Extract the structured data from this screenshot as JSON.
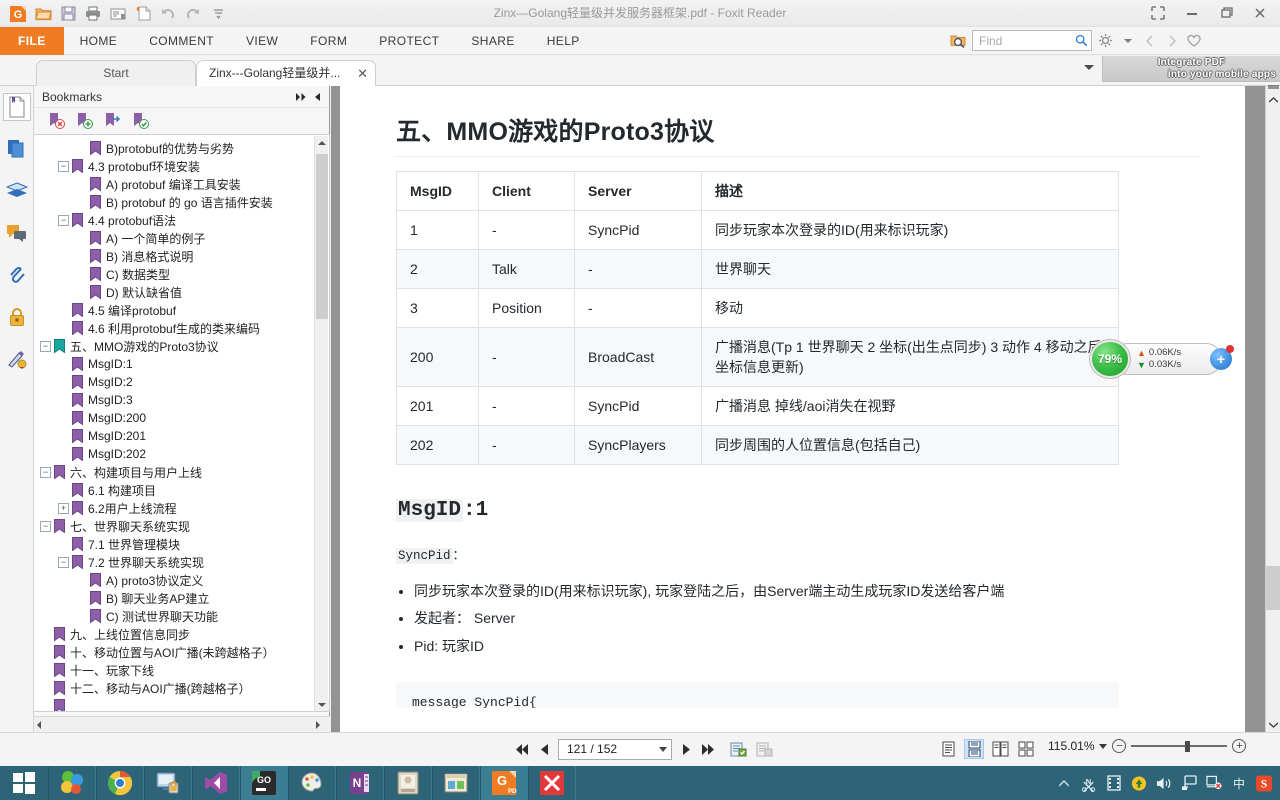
{
  "window": {
    "title": "Zinx—Golang轻量级并发服务器框架.pdf - Foxit Reader",
    "restore_icon": "restore-icon",
    "minimize_icon": "minimize-icon",
    "maximize_icon": "maximize-icon",
    "close_icon": "close-icon"
  },
  "quick_access": [
    {
      "name": "foxit-logo-icon",
      "glyph": "G"
    },
    {
      "name": "open-icon",
      "glyph": "Ὄ2"
    },
    {
      "name": "save-icon",
      "glyph": "■"
    },
    {
      "name": "print-icon",
      "glyph": "⎙"
    },
    {
      "name": "email-icon",
      "glyph": "✉"
    },
    {
      "name": "create-pdf-icon",
      "glyph": "✳"
    },
    {
      "name": "undo-icon",
      "glyph": "↶"
    },
    {
      "name": "redo-icon",
      "glyph": "↷"
    },
    {
      "name": "customize-qat-icon",
      "glyph": "▾"
    }
  ],
  "ribbon": {
    "tabs": [
      {
        "label": "FILE",
        "active": true
      },
      {
        "label": "HOME",
        "active": false
      },
      {
        "label": "COMMENT",
        "active": false
      },
      {
        "label": "VIEW",
        "active": false
      },
      {
        "label": "FORM",
        "active": false
      },
      {
        "label": "PROTECT",
        "active": false
      },
      {
        "label": "SHARE",
        "active": false
      },
      {
        "label": "HELP",
        "active": false
      }
    ],
    "search": {
      "placeholder": "Find",
      "value": "",
      "search_icon": "magnifier-icon",
      "scope_icon": "search-scope-icon"
    },
    "settings_icon": "gear-icon",
    "settings_dropdown_icon": "chevron-down-icon",
    "prev_icon": "previous-result-icon",
    "next_icon": "next-result-icon",
    "favorite_icon": "heart-icon"
  },
  "banner": {
    "line1": "Integrate PDF",
    "line2": "into your mobile apps"
  },
  "doc_tabs": {
    "tabs": [
      {
        "label": "Start",
        "active": false,
        "closable": false
      },
      {
        "label": "Zinx---Golang轻量级并...",
        "active": true,
        "closable": true
      }
    ],
    "close_glyph": "✕",
    "overflow_icon": "chevron-down-icon"
  },
  "rail": [
    {
      "name": "bookmarks-panel-icon",
      "selected": true
    },
    {
      "name": "pages-thumbnails-panel-icon",
      "selected": false
    },
    {
      "name": "layers-panel-icon",
      "selected": false
    },
    {
      "name": "comments-panel-icon",
      "selected": false
    },
    {
      "name": "attachments-panel-icon",
      "selected": false
    },
    {
      "name": "security-panel-icon",
      "selected": false
    },
    {
      "name": "signatures-panel-icon",
      "selected": false
    }
  ],
  "bookmarks_panel": {
    "title": "Bookmarks",
    "expand_all_icon": "expand-all-icon",
    "collapse_icon": "collapse-panel-icon",
    "tools": [
      {
        "name": "delete-bookmark-icon"
      },
      {
        "name": "add-bookmark-icon"
      },
      {
        "name": "goto-bookmark-icon"
      },
      {
        "name": "edit-bookmark-icon"
      }
    ],
    "items": [
      {
        "label": "B)protobuf的优势与劣势",
        "depth": 3,
        "toggle": "none",
        "current": false
      },
      {
        "label": "4.3 protobuf环境安装",
        "depth": 2,
        "toggle": "minus",
        "current": false
      },
      {
        "label": "A) protobuf 编译工具安装",
        "depth": 3,
        "toggle": "none",
        "current": false
      },
      {
        "label": "B) protobuf 的 go 语言插件安装",
        "depth": 3,
        "toggle": "none",
        "current": false
      },
      {
        "label": "4.4 protobuf语法",
        "depth": 2,
        "toggle": "minus",
        "current": false
      },
      {
        "label": "A) 一个简单的例子",
        "depth": 3,
        "toggle": "none",
        "current": false
      },
      {
        "label": "B) 消息格式说明",
        "depth": 3,
        "toggle": "none",
        "current": false
      },
      {
        "label": "C) 数据类型",
        "depth": 3,
        "toggle": "none",
        "current": false
      },
      {
        "label": "D) 默认缺省值",
        "depth": 3,
        "toggle": "none",
        "current": false
      },
      {
        "label": "4.5 编译protobuf",
        "depth": 2,
        "toggle": "none",
        "current": false
      },
      {
        "label": "4.6 利用protobuf生成的类来编码",
        "depth": 2,
        "toggle": "none",
        "current": false
      },
      {
        "label": "五、MMO游戏的Proto3协议",
        "depth": 1,
        "toggle": "minus",
        "current": true
      },
      {
        "label": "MsgID:1",
        "depth": 2,
        "toggle": "none",
        "current": false
      },
      {
        "label": "MsgID:2",
        "depth": 2,
        "toggle": "none",
        "current": false
      },
      {
        "label": "MsgID:3",
        "depth": 2,
        "toggle": "none",
        "current": false
      },
      {
        "label": "MsgID:200",
        "depth": 2,
        "toggle": "none",
        "current": false
      },
      {
        "label": "MsgID:201",
        "depth": 2,
        "toggle": "none",
        "current": false
      },
      {
        "label": "MsgID:202",
        "depth": 2,
        "toggle": "none",
        "current": false
      },
      {
        "label": "六、构建项目与用户上线",
        "depth": 1,
        "toggle": "minus",
        "current": false
      },
      {
        "label": "6.1 构建项目",
        "depth": 2,
        "toggle": "none",
        "current": false
      },
      {
        "label": "6.2用户上线流程",
        "depth": 2,
        "toggle": "plus",
        "current": false
      },
      {
        "label": "七、世界聊天系统实现",
        "depth": 1,
        "toggle": "minus",
        "current": false
      },
      {
        "label": "7.1 世界管理模块",
        "depth": 2,
        "toggle": "none",
        "current": false
      },
      {
        "label": "7.2 世界聊天系统实现",
        "depth": 2,
        "toggle": "minus",
        "current": false
      },
      {
        "label": "A) proto3协议定义",
        "depth": 3,
        "toggle": "none",
        "current": false
      },
      {
        "label": "B) 聊天业务AP建立",
        "depth": 3,
        "toggle": "none",
        "current": false
      },
      {
        "label": "C) 测试世界聊天功能",
        "depth": 3,
        "toggle": "none",
        "current": false
      },
      {
        "label": "九、上线位置信息同步",
        "depth": 1,
        "toggle": "none",
        "current": false
      },
      {
        "label": "十、移动位置与AOI广播(未跨越格子）",
        "depth": 1,
        "toggle": "none",
        "current": false
      },
      {
        "label": "十一、玩家下线",
        "depth": 1,
        "toggle": "none",
        "current": false
      },
      {
        "label": "十二、移动与AOI广播(跨越格子）",
        "depth": 1,
        "toggle": "none",
        "current": false
      },
      {
        "label": "",
        "depth": 1,
        "toggle": "none",
        "current": false
      }
    ]
  },
  "document": {
    "heading": "五、MMO游戏的Proto3协议",
    "table": {
      "headers": [
        "MsgID",
        "Client",
        "Server",
        "描述"
      ],
      "rows": [
        [
          "1",
          "-",
          "SyncPid",
          "同步玩家本次登录的ID(用来标识玩家)"
        ],
        [
          "2",
          "Talk",
          "-",
          "世界聊天"
        ],
        [
          "3",
          "Position",
          "-",
          "移动"
        ],
        [
          "200",
          "-",
          "BroadCast",
          "广播消息(Tp 1 世界聊天 2 坐标(出生点同步) 3 动作 4 移动之后坐标信息更新)"
        ],
        [
          "201",
          "-",
          "SyncPid",
          "广播消息 掉线/aoi消失在视野"
        ],
        [
          "202",
          "-",
          "SyncPlayers",
          "同步周围的人位置信息(包括自己)"
        ]
      ]
    },
    "section": {
      "heading_mono": "MsgID",
      "heading_rest": ":1",
      "code_label": "SyncPid",
      "code_colon": "：",
      "bullets": [
        "同步玩家本次登录的ID(用来标识玩家), 玩家登陆之后，由Server端主动生成玩家ID发送给客户端",
        "发起者：  Server",
        "Pid: 玩家ID"
      ],
      "codeblock": "message SyncPid{"
    }
  },
  "network_widget": {
    "percent": "79%",
    "upload": "0.06K/s",
    "download": "0.03K/s",
    "upload_icon": "arrow-up-icon",
    "download_icon": "arrow-down-icon",
    "accelerate_icon": "plus-circle-icon",
    "badge_icon": "notification-dot-icon",
    "accent_color": "#2fb43c"
  },
  "status_bar": {
    "first_page_icon": "first-page-icon",
    "prev_page_icon": "previous-page-icon",
    "page_value": "121 / 152",
    "page_dropdown_icon": "chevron-down-icon",
    "next_page_icon": "next-page-icon",
    "last_page_icon": "last-page-icon",
    "fit_page_icon": "fit-page-icon",
    "fit_width_icon": "fit-width-icon",
    "view_modes": [
      {
        "name": "single-page-view-icon",
        "selected": false
      },
      {
        "name": "continuous-scroll-view-icon",
        "selected": true
      },
      {
        "name": "facing-view-icon",
        "selected": false
      },
      {
        "name": "continuous-facing-view-icon",
        "selected": false
      }
    ],
    "zoom_value": "115.01%",
    "zoom_dropdown_icon": "chevron-down-icon",
    "zoom_out_icon": "minus-circle-icon",
    "zoom_in_icon": "plus-circle-icon",
    "slider_name": "zoom-slider"
  },
  "taskbar": {
    "start_icon": "windows-start-icon",
    "apps": [
      {
        "name": "taskbar-app-colorful-balls",
        "active": false
      },
      {
        "name": "taskbar-app-google-chrome",
        "active": false
      },
      {
        "name": "taskbar-app-remote-desktop",
        "active": false
      },
      {
        "name": "taskbar-app-visual-studio",
        "active": false
      },
      {
        "name": "taskbar-app-goland",
        "active": true
      },
      {
        "name": "taskbar-app-paint",
        "active": false
      },
      {
        "name": "taskbar-app-onenote",
        "active": false
      },
      {
        "name": "taskbar-app-ebook-reader",
        "active": false
      },
      {
        "name": "taskbar-app-file-explorer",
        "active": false
      },
      {
        "name": "taskbar-app-foxit-reader",
        "active": true
      },
      {
        "name": "taskbar-app-xmind",
        "active": false
      }
    ],
    "tray": [
      {
        "name": "show-hidden-icons-icon",
        "glyph": "▲"
      },
      {
        "name": "screenshot-tool-icon",
        "glyph": "✂"
      },
      {
        "name": "screen-recorder-icon",
        "glyph": "▦"
      },
      {
        "name": "update-available-icon",
        "glyph": "⬆"
      },
      {
        "name": "volume-icon",
        "glyph": "ὐA"
      },
      {
        "name": "network-icon",
        "glyph": "὚7"
      },
      {
        "name": "action-center-icon",
        "glyph": "ὊC"
      },
      {
        "name": "ime-language-icon",
        "glyph": "中"
      },
      {
        "name": "sogou-input-icon",
        "glyph": "S"
      }
    ]
  }
}
